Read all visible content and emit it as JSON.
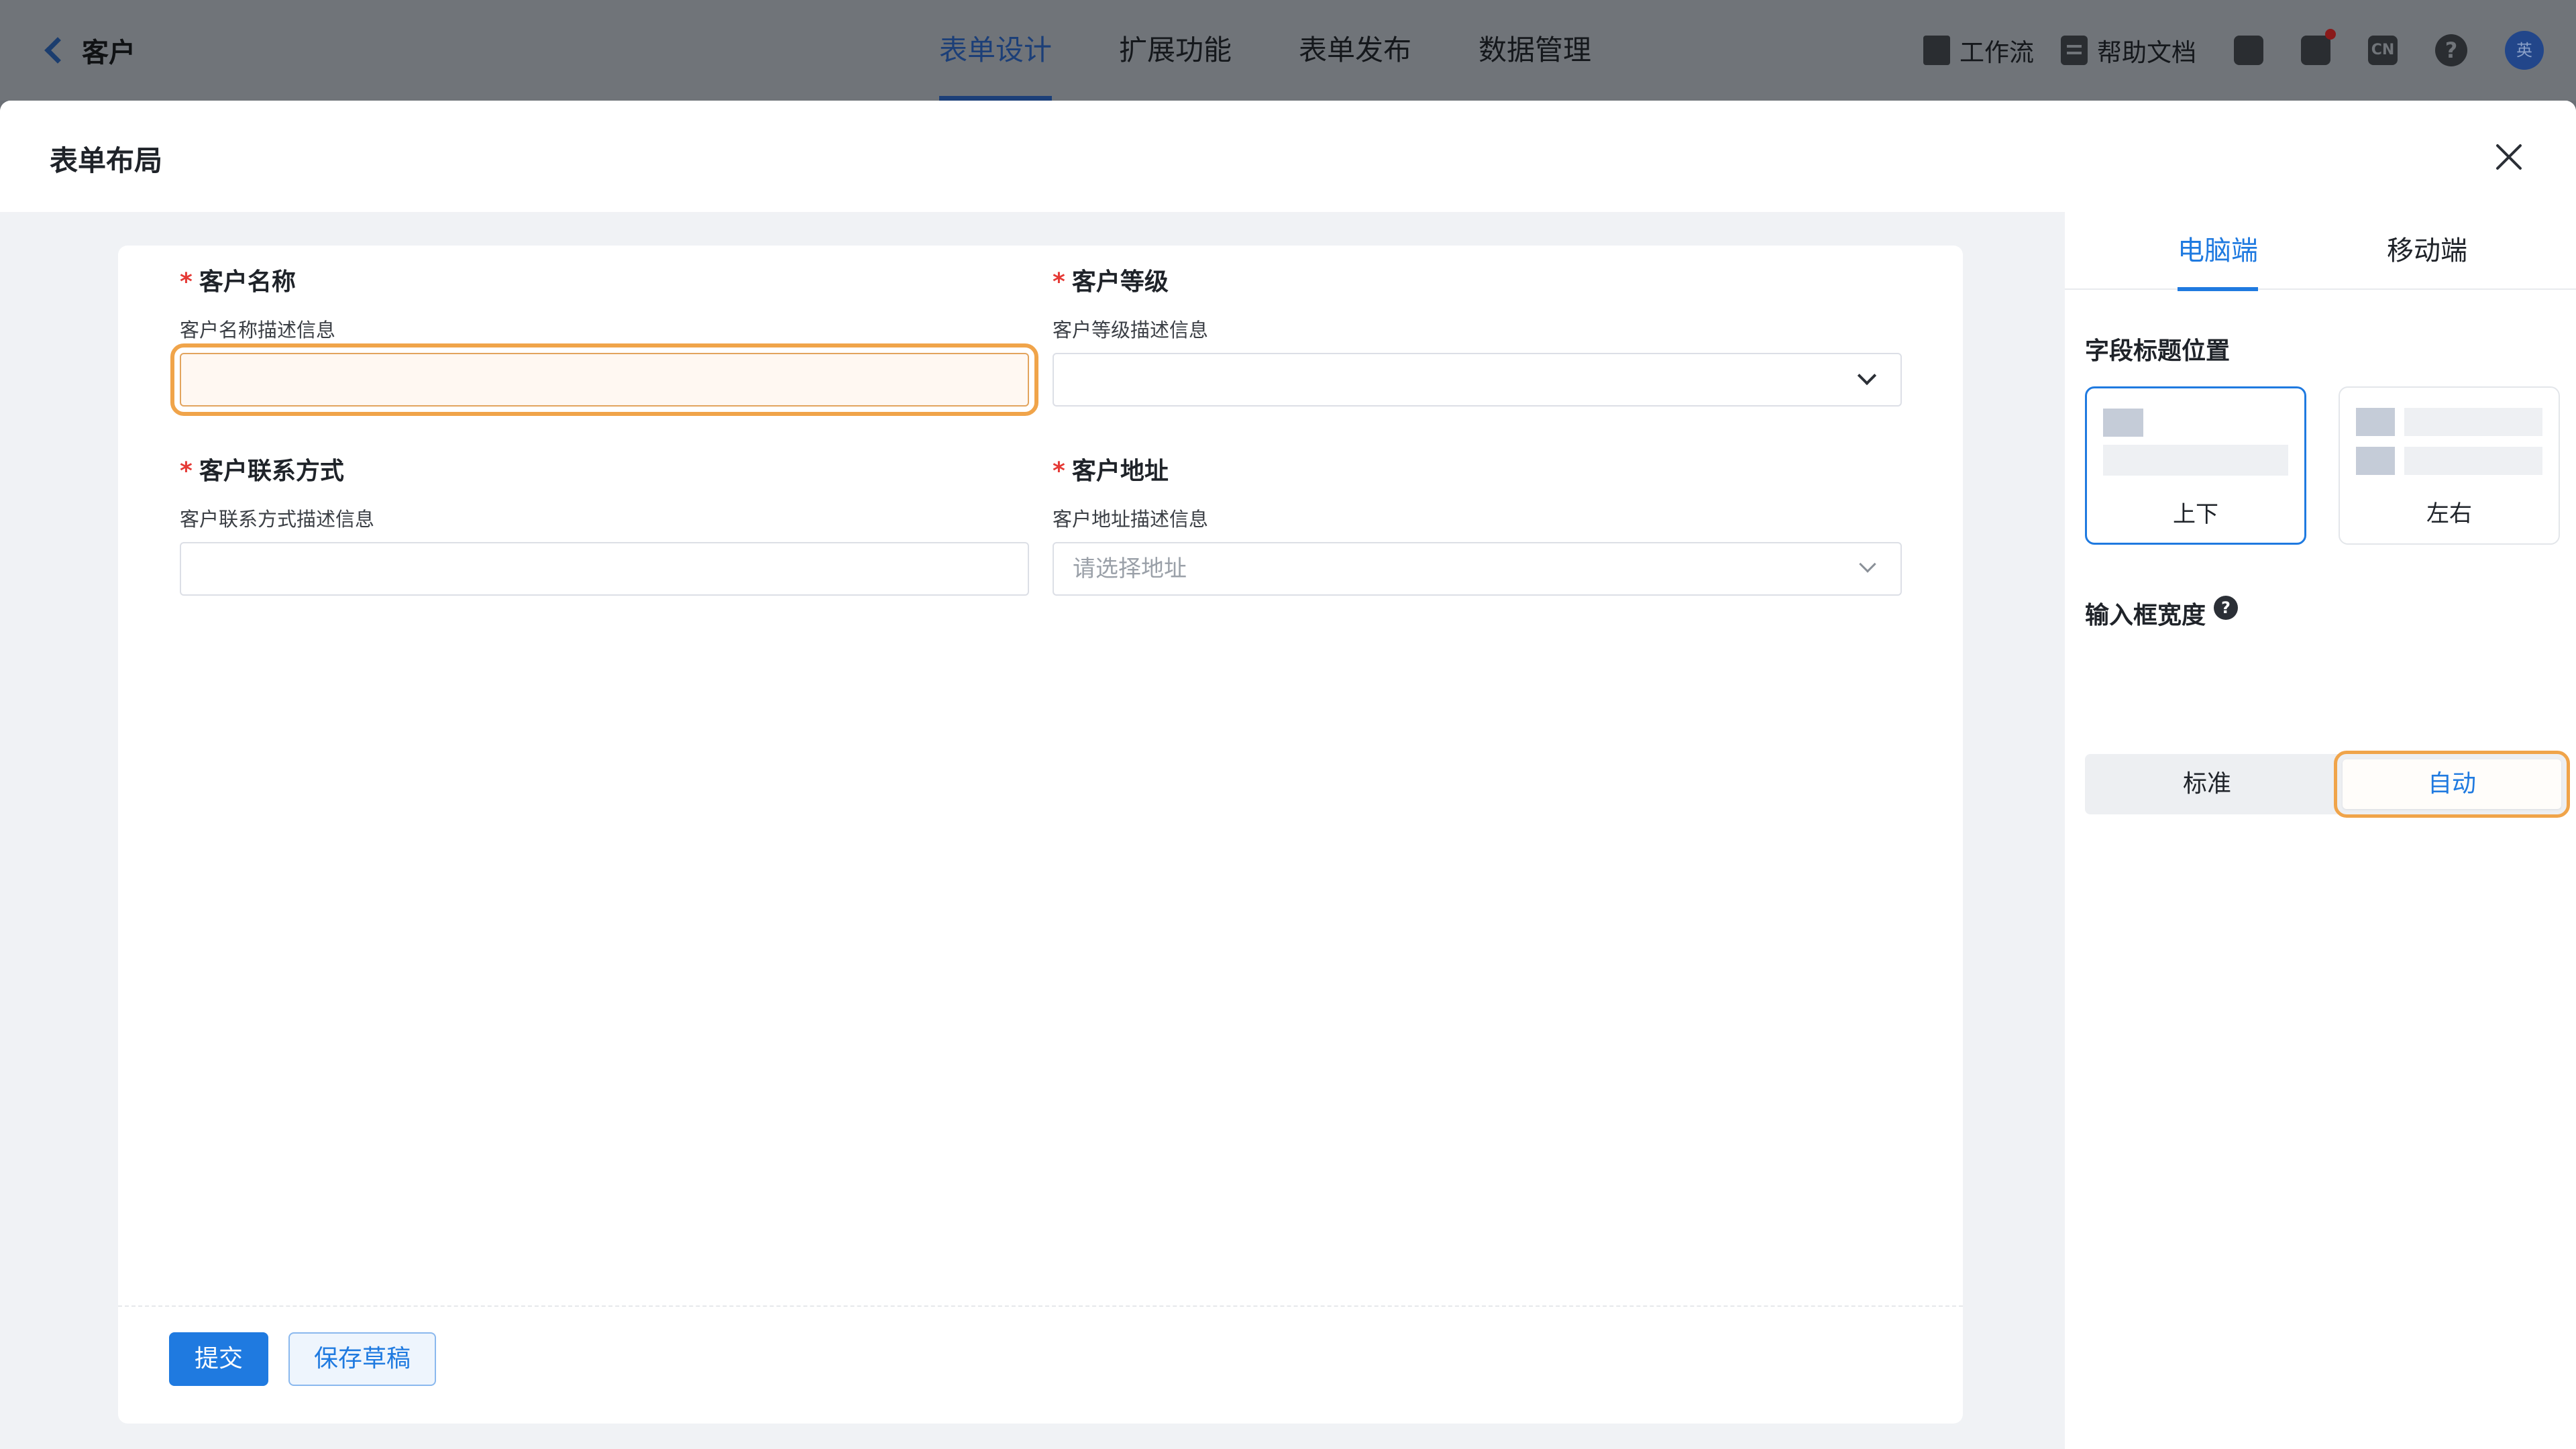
{
  "topbar": {
    "back_title": "客户",
    "tabs": [
      {
        "label": "表单设计",
        "active": true
      },
      {
        "label": "扩展功能",
        "active": false
      },
      {
        "label": "表单发布",
        "active": false
      },
      {
        "label": "数据管理",
        "active": false
      }
    ],
    "workflow_label": "工作流",
    "help_docs_label": "帮助文档",
    "lang_badge": "CN",
    "help_glyph": "?",
    "avatar_text": "英"
  },
  "modal": {
    "title": "表单布局"
  },
  "form": {
    "fields": [
      {
        "label": "客户名称",
        "required_mark": "*",
        "description": "客户名称描述信息",
        "value": "",
        "placeholder": ""
      },
      {
        "label": "客户等级",
        "required_mark": "*",
        "description": "客户等级描述信息",
        "value": "",
        "placeholder": ""
      },
      {
        "label": "客户联系方式",
        "required_mark": "*",
        "description": "客户联系方式描述信息",
        "value": "",
        "placeholder": ""
      },
      {
        "label": "客户地址",
        "required_mark": "*",
        "description": "客户地址描述信息",
        "value": "",
        "placeholder": "请选择地址"
      }
    ],
    "submit_label": "提交",
    "draft_label": "保存草稿"
  },
  "side_panel": {
    "tabs": [
      {
        "label": "电脑端",
        "active": true
      },
      {
        "label": "移动端",
        "active": false
      }
    ],
    "label_position_title": "字段标题位置",
    "label_position_options": [
      {
        "label": "上下",
        "selected": true
      },
      {
        "label": "左右",
        "selected": false
      }
    ],
    "input_width_title": "输入框宽度",
    "input_width_help": "?",
    "input_width_options": [
      {
        "label": "标准",
        "selected": false
      },
      {
        "label": "自动",
        "selected": true
      }
    ]
  },
  "colors": {
    "accent": "#1f7ae0",
    "required": "#e53935",
    "focus_highlight": "#f0a44a"
  }
}
